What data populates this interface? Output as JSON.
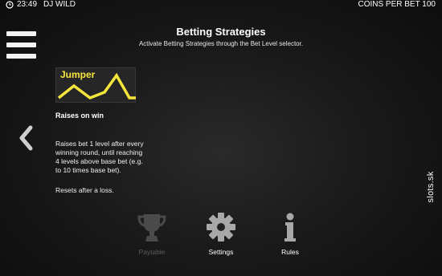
{
  "status_bar": {
    "time": "23:49",
    "game_name": "DJ WILD",
    "coins_per_bet": "COINS PER BET 100"
  },
  "header": {
    "title": "Betting Strategies",
    "subtitle": "Activate Betting Strategies through the Bet Level selector."
  },
  "strategy": {
    "name": "Jumper",
    "graph_color": "#f5e63c",
    "trigger": "Raises on win",
    "description": "Raises bet 1 level after every\nwinning round, until reaching\n4 levels above base bet (e.g.\nto 10 times base bet).",
    "reset_note": "Resets after a loss."
  },
  "bottom_nav": {
    "paytable_label": "Paytable",
    "settings_label": "Settings",
    "rules_label": "Rules"
  },
  "watermark": "slots.sk",
  "icons": {
    "menu": "hamburger-menu-icon",
    "back": "chevron-left-icon",
    "paytable": "trophy-icon",
    "settings": "gear-icon",
    "rules": "info-icon",
    "clock": "clock-icon"
  }
}
